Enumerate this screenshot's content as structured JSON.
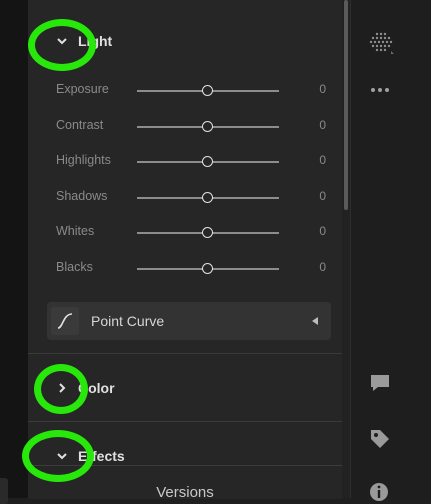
{
  "sections": {
    "light": {
      "title": "Light",
      "expanded": true
    },
    "color": {
      "title": "Color",
      "expanded": false
    },
    "effects": {
      "title": "Effects",
      "expanded": true
    }
  },
  "sliders": [
    {
      "label": "Exposure",
      "value": "0",
      "position": 0.5
    },
    {
      "label": "Contrast",
      "value": "0",
      "position": 0.5
    },
    {
      "label": "Highlights",
      "value": "0",
      "position": 0.5
    },
    {
      "label": "Shadows",
      "value": "0",
      "position": 0.5
    },
    {
      "label": "Whites",
      "value": "0",
      "position": 0.5
    },
    {
      "label": "Blacks",
      "value": "0",
      "position": 0.5
    }
  ],
  "point_curve": {
    "label": "Point Curve"
  },
  "versions": {
    "label": "Versions"
  },
  "right_toolbar": {
    "icons": [
      "presets-dots-icon",
      "more-icon",
      "comment-icon",
      "tag-icon",
      "info-icon"
    ]
  },
  "highlight_color": "#27e80a"
}
